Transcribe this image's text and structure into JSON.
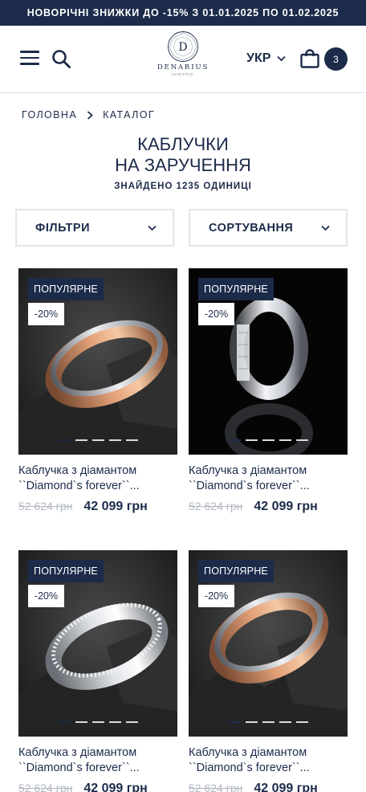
{
  "promo_banner": "НОВОРІЧНІ ЗНИЖКИ ДО -15% З 01.01.2025 ПО 01.02.2025",
  "header": {
    "logo_brand": "DENARIUS",
    "logo_letter": "D",
    "logo_sub": "jewelry",
    "language": "УКР",
    "cart_count": "3"
  },
  "breadcrumb": [
    "ГОЛОВНА",
    "КАТАЛОГ"
  ],
  "page": {
    "title_line1": "КАБЛУЧКИ",
    "title_line2": "НА ЗАРУЧЕННЯ",
    "found": "ЗНАЙДЕНО 1235 ОДИНИЦІ"
  },
  "controls": {
    "filters": "ФІЛЬТРИ",
    "sort": "СОРТУВАННЯ"
  },
  "products": [
    {
      "badge": "ПОПУЛЯРНЕ",
      "discount": "-20%",
      "name_line1": "Каблучка з діамантом",
      "name_line2": "``Diamond`s forever``...",
      "old_price": "52 624 грн",
      "new_price": "42 099 грн",
      "metal": "rose-gold"
    },
    {
      "badge": "ПОПУЛЯРНЕ",
      "discount": "-20%",
      "name_line1": "Каблучка з діамантом",
      "name_line2": "``Diamond`s forever``...",
      "old_price": "52 624 грн",
      "new_price": "42 099 грн",
      "metal": "white-gold"
    },
    {
      "badge": "ПОПУЛЯРНЕ",
      "discount": "-20%",
      "name_line1": "Каблучка з діамантом",
      "name_line2": "``Diamond`s forever``...",
      "old_price": "52 624 грн",
      "new_price": "42 099 грн",
      "metal": "white-gold"
    },
    {
      "badge": "ПОПУЛЯРНЕ",
      "discount": "-20%",
      "name_line1": "Каблучка з діамантом",
      "name_line2": "``Diamond`s forever``...",
      "old_price": "52 624 грн",
      "new_price": "42 099 грн",
      "metal": "rose-gold"
    }
  ],
  "colors": {
    "navy": "#1c2b4a",
    "muted_price": "#b3b8c3"
  }
}
